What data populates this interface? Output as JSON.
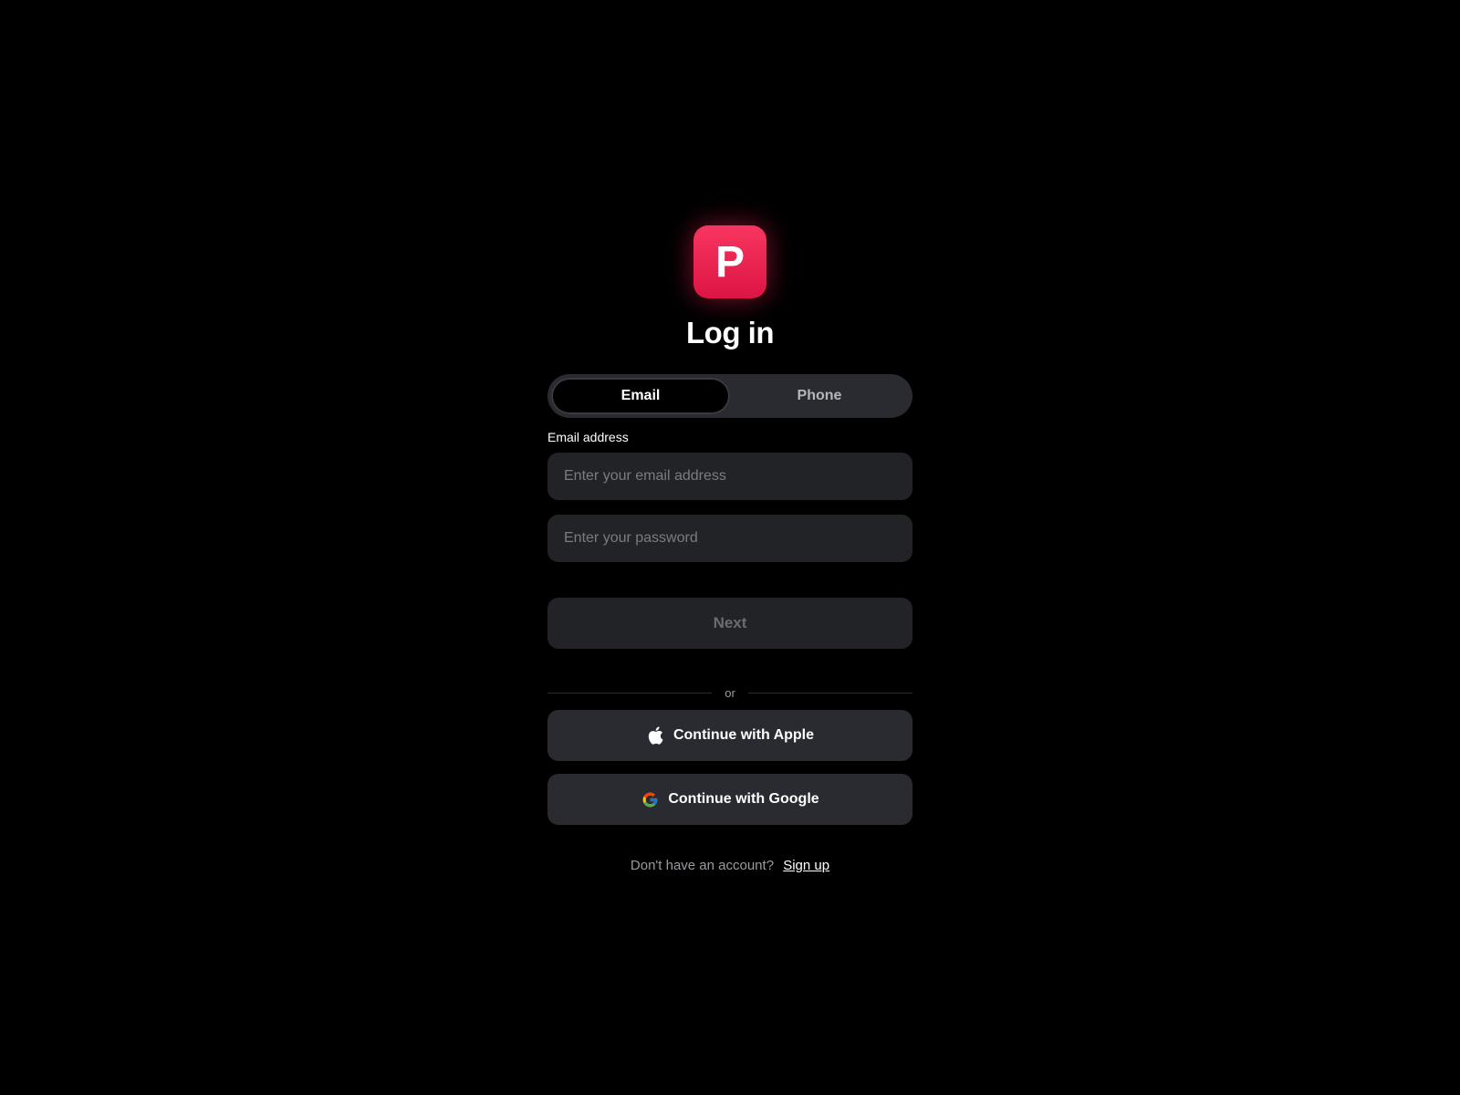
{
  "logo": {
    "letter": "P",
    "color": "#e8204f"
  },
  "title": "Log in",
  "tabs": [
    {
      "label": "Email",
      "active": true
    },
    {
      "label": "Phone",
      "active": false
    }
  ],
  "form": {
    "email_label": "Email address",
    "email_placeholder": "Enter your email address",
    "email_value": "",
    "password_placeholder": "Enter your password",
    "password_value": ""
  },
  "next_label": "Next",
  "divider_text": "or",
  "social": {
    "apple_label": "Continue with Apple",
    "apple_icon": "apple-icon",
    "google_label": "Continue with Google",
    "google_icon": "google-icon"
  },
  "signup": {
    "prompt": "Don't have an account?",
    "link_label": "Sign up"
  }
}
